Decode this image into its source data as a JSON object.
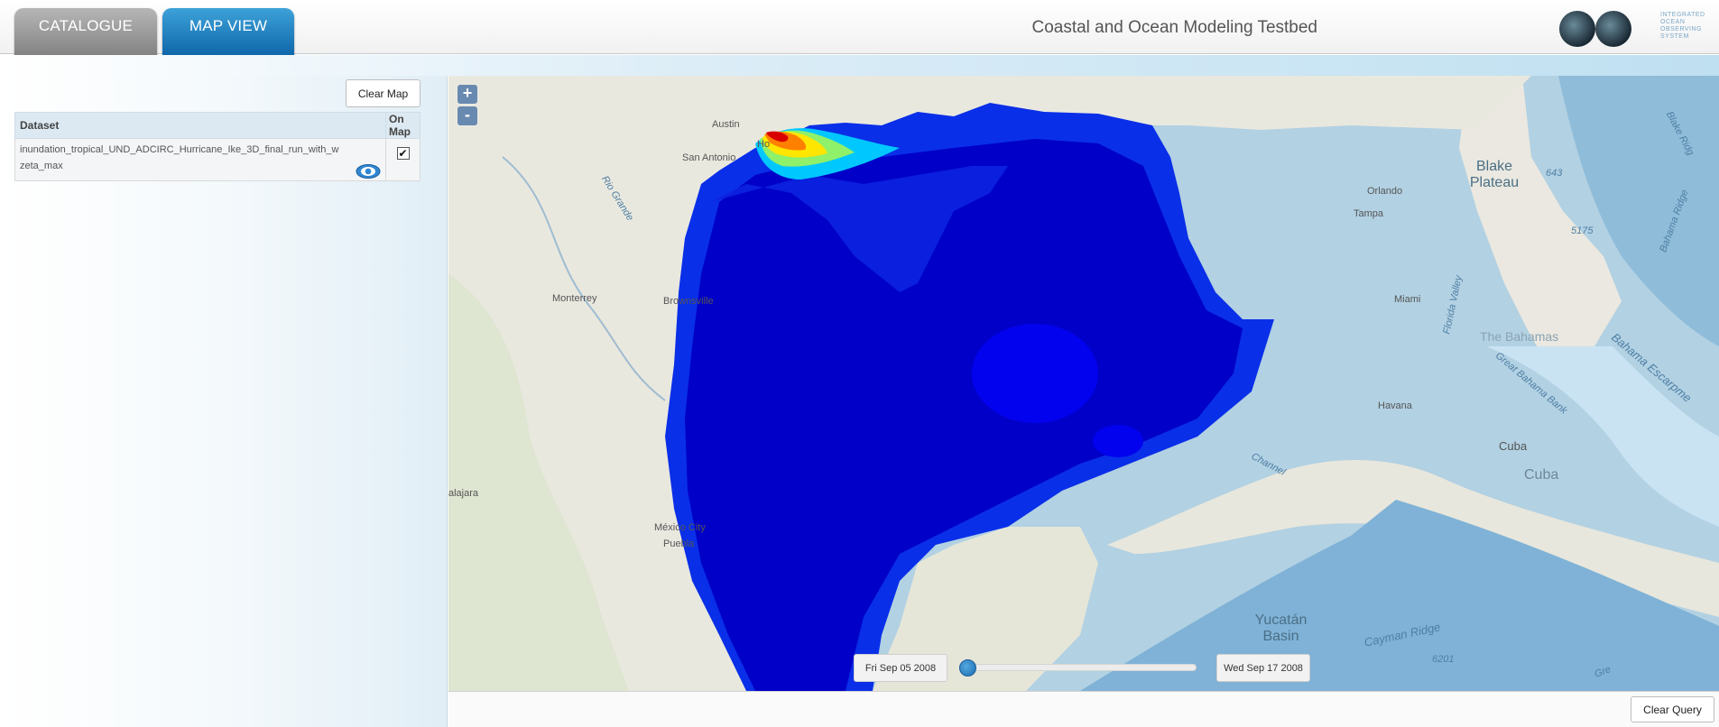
{
  "header": {
    "tabs": [
      {
        "label": "CATALOGUE"
      },
      {
        "label": "MAP VIEW",
        "active": true
      }
    ],
    "app_title": "Coastal and Ocean Modeling Testbed",
    "logo": {
      "word": "IOOS",
      "subtitle": "INTEGRATED OCEAN OBSERVING SYSTEM"
    }
  },
  "left_panel": {
    "clear_map_label": "Clear Map",
    "table": {
      "columns": [
        "Dataset",
        "On Map"
      ],
      "rows": [
        {
          "dataset": "inundation_tropical_UND_ADCIRC_Hurricane_Ike_3D_final_run_with_w",
          "variable": "zeta_max",
          "on_map": true,
          "check_glyph": "✔"
        }
      ]
    }
  },
  "map": {
    "zoom_in": "+",
    "zoom_out": "-",
    "labels": {
      "austin": "Austin",
      "houston": "Ho",
      "san_antonio": "San Antonio",
      "rio_grande": "Rio Grande",
      "monterrey": "Monterrey",
      "brownsville": "Brownsville",
      "orlando": "Orlando",
      "tampa": "Tampa",
      "miami": "Miami",
      "florida_valley": "Florida Valley",
      "blake_plateau": "Blake Plateau",
      "blake_ridge": "Blake Ridg",
      "depth_643": "643",
      "depth_5175": "5175",
      "bahama_ridge": "Bahama Ridge",
      "the_bahamas": "The Bahamas",
      "great_bahama_bank": "Great Bahama Bank",
      "bahama_escarpment": "Bahama Escarpme",
      "havana": "Havana",
      "cuba_1": "Cuba",
      "cuba_2": "Cuba",
      "channel": "Channel",
      "guadalajara": "alajara",
      "mexico_city": "México City",
      "puebla": "Puebla",
      "yucatan_basin": "Yucatán Basin",
      "cayman_ridge": "Cayman Ridge",
      "depth_6201": "6201",
      "gre": "Gre"
    },
    "time_slider": {
      "start_label": "Fri Sep 05 2008",
      "end_label": "Wed Sep 17 2008",
      "position": 0.0
    }
  },
  "footer": {
    "clear_query_label": "Clear Query"
  },
  "colors": {
    "tab_active": "#0b61a5",
    "tab_inactive": "#8a8a8a",
    "gulf_deep": "#0202a8",
    "gulf_mid": "#0000ee",
    "gulf_shelf": "#1e6cff",
    "surge_high": "#d90000"
  }
}
